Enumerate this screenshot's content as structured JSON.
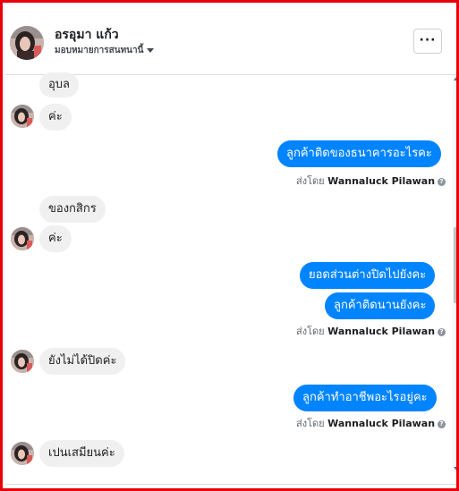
{
  "header": {
    "name": "อรอุมา แก้ว",
    "subtitle": "มอบหมายการสนทนานี้",
    "more_label": "···"
  },
  "messages": {
    "m1": "อุบล",
    "m2": "ค่ะ",
    "m3": "ลูกค้าติดของธนาคารอะไรคะ",
    "m4": "ของกสิกร",
    "m5": "ค่ะ",
    "m6": "ยอดส่วนต่างปิดไปยังคะ",
    "m7": "ลูกค้าติดนานยังคะ",
    "m8": "ยังไม่ได้ปิดค่ะ",
    "m9": "ลูกค้าทำอาชีพอะไรอยู่คะ",
    "m10": "เปนเสมียนค่ะ"
  },
  "sent_by": {
    "prefix": "ส่งโดย",
    "agent": "Wannaluck Pilawan",
    "help_icon_glyph": "?"
  },
  "colors": {
    "frame_border": "#e8000b",
    "outgoing_bubble": "#0084ff",
    "incoming_bubble": "#f1f0f0"
  },
  "icons": {
    "caret": "chevron-down-icon",
    "more": "more-horizontal-icon",
    "help": "question-circle-icon"
  }
}
